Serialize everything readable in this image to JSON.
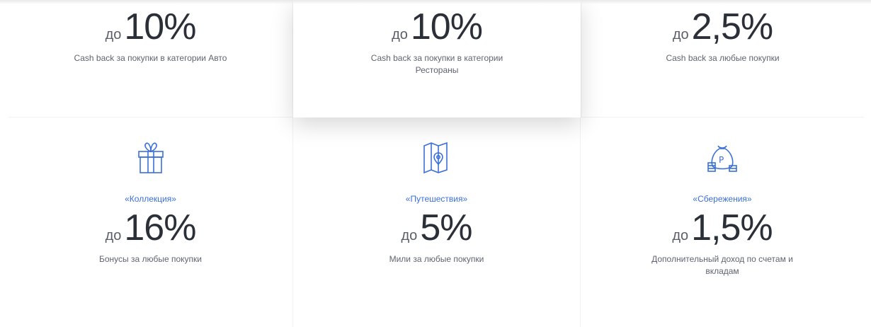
{
  "colors": {
    "accent": "#3a6fd8",
    "text_dark": "#2b2f38",
    "text_muted": "#5f6470"
  },
  "top_cards": [
    {
      "prefix": "до",
      "value": "10%",
      "description": "Cash back за покупки в категории Авто"
    },
    {
      "prefix": "до",
      "value": "10%",
      "description": "Cash back за покупки в категории Рестораны"
    },
    {
      "prefix": "до",
      "value": "2,5%",
      "description": "Cash back за любые покупки"
    }
  ],
  "bottom_cards": [
    {
      "icon": "gift-icon",
      "program": "«Коллекция»",
      "prefix": "до",
      "value": "16%",
      "description": "Бонусы за любые покупки"
    },
    {
      "icon": "map-pin-icon",
      "program": "«Путешествия»",
      "prefix": "до",
      "value": "5%",
      "description": "Мили за любые покупки"
    },
    {
      "icon": "money-bag-icon",
      "program": "«Сбережения»",
      "prefix": "до",
      "value": "1,5%",
      "description": "Дополнительный доход по счетам и вкладам"
    }
  ]
}
